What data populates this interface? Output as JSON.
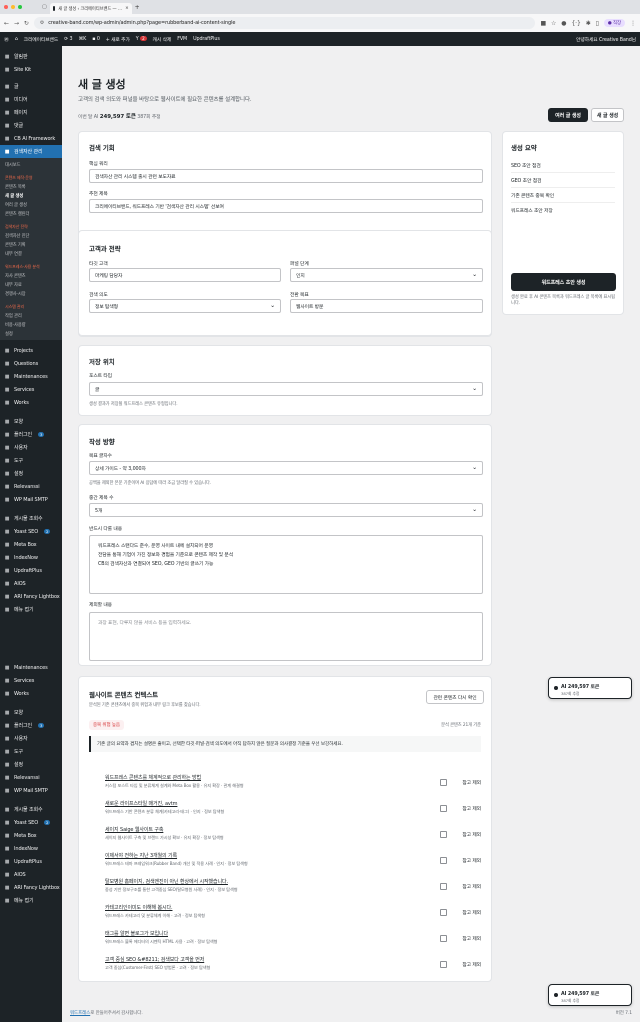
{
  "browser": {
    "tab_title": "새 글 생성 ‹ 크리에이티브밴드 — …",
    "url": "creative-band.com/wp-admin/admin.php?page=rubberband-ai-content-single",
    "profile": "직장",
    "new_tab": "+"
  },
  "adminbar": {
    "site": "크리에이티브밴드",
    "updates": "3",
    "comments": "0",
    "new": "+ 새로 추가",
    "yoast_count": "2",
    "cache": "캐시 삭제",
    "fvm": "FVM",
    "updraft": "UpdraftPlus",
    "greeting": "안녕하세요 Creative Band님"
  },
  "sidebar": {
    "top": [
      {
        "label": "알림판",
        "icon": "dashboard-icon"
      },
      {
        "label": "Site Kit",
        "icon": "sitekit-icon"
      }
    ],
    "mid": [
      {
        "label": "글",
        "icon": "pin-icon"
      },
      {
        "label": "미디어",
        "icon": "media-icon"
      },
      {
        "label": "페이지",
        "icon": "page-icon"
      },
      {
        "label": "댓글",
        "icon": "comment-icon"
      },
      {
        "label": "CB AI Framework",
        "icon": "ai-icon"
      },
      {
        "label": "검색자산 관리",
        "icon": "search-asset-icon"
      }
    ],
    "sub": [
      {
        "label": "대시보드",
        "type": "item"
      },
      {
        "label": "",
        "type": "gap"
      },
      {
        "label": "콘텐츠 제작·운영",
        "type": "grp"
      },
      {
        "label": "콘텐츠 목록",
        "type": "item"
      },
      {
        "label": "새 글 생성",
        "type": "cur"
      },
      {
        "label": "여러 글 생성",
        "type": "item"
      },
      {
        "label": "콘텐츠 캘린더",
        "type": "item"
      },
      {
        "label": "",
        "type": "gap"
      },
      {
        "label": "검색자산 전략",
        "type": "grp"
      },
      {
        "label": "검색자산 진단",
        "type": "item"
      },
      {
        "label": "콘텐츠 기획",
        "type": "item"
      },
      {
        "label": "내부 연결",
        "type": "item"
      },
      {
        "label": "",
        "type": "gap"
      },
      {
        "label": "워드프레스·사용 분석",
        "type": "grp"
      },
      {
        "label": "자사 콘텐츠",
        "type": "item"
      },
      {
        "label": "내부 자료",
        "type": "item"
      },
      {
        "label": "경쟁사·시장",
        "type": "item"
      },
      {
        "label": "",
        "type": "gap"
      },
      {
        "label": "시스템 관리",
        "type": "grp"
      },
      {
        "label": "작업 관리",
        "type": "item"
      },
      {
        "label": "비용·사용량",
        "type": "item"
      },
      {
        "label": "설정",
        "type": "item"
      }
    ],
    "bottom": [
      {
        "label": "Projects",
        "icon": "projects-icon"
      },
      {
        "label": "Questions",
        "icon": "questions-icon"
      },
      {
        "label": "Maintenances",
        "icon": "maintenance-icon"
      },
      {
        "label": "Services",
        "icon": "services-icon"
      },
      {
        "label": "Works",
        "icon": "works-icon"
      },
      {
        "label": "",
        "icon": ""
      },
      {
        "label": "모양",
        "icon": "brush-icon"
      },
      {
        "label": "플러그인",
        "icon": "plugin-icon",
        "count": "3"
      },
      {
        "label": "사용자",
        "icon": "user-icon"
      },
      {
        "label": "도구",
        "icon": "tool-icon"
      },
      {
        "label": "설정",
        "icon": "settings-icon"
      },
      {
        "label": "Relevanssi",
        "icon": "relevanssi-icon"
      },
      {
        "label": "WP Mail SMTP",
        "icon": "mail-icon"
      },
      {
        "label": "",
        "icon": ""
      },
      {
        "label": "게시물 조회수",
        "icon": "chart-icon"
      },
      {
        "label": "Yoast SEO",
        "icon": "yoast-icon",
        "count": "2"
      },
      {
        "label": "Meta Box",
        "icon": "metabox-icon"
      },
      {
        "label": "IndexNow",
        "icon": "indexnow-icon"
      },
      {
        "label": "UpdraftPlus",
        "icon": "updraft-icon"
      },
      {
        "label": "AIOS",
        "icon": "aios-icon"
      },
      {
        "label": "ARI Fancy Lightbox",
        "icon": "lightbox-icon"
      },
      {
        "label": "메뉴 접기",
        "icon": "collapse-icon"
      }
    ],
    "repeat": [
      {
        "label": "Maintenances",
        "icon": "maintenance-icon"
      },
      {
        "label": "Services",
        "icon": "services-icon"
      },
      {
        "label": "Works",
        "icon": "works-icon"
      },
      {
        "label": "",
        "icon": ""
      },
      {
        "label": "모양",
        "icon": "brush-icon"
      },
      {
        "label": "플러그인",
        "icon": "plugin-icon",
        "count": "3"
      },
      {
        "label": "사용자",
        "icon": "user-icon"
      },
      {
        "label": "도구",
        "icon": "tool-icon"
      },
      {
        "label": "설정",
        "icon": "settings-icon"
      },
      {
        "label": "Relevanssi",
        "icon": "relevanssi-icon"
      },
      {
        "label": "WP Mail SMTP",
        "icon": "mail-icon"
      },
      {
        "label": "",
        "icon": ""
      },
      {
        "label": "게시물 조회수",
        "icon": "chart-icon"
      },
      {
        "label": "Yoast SEO",
        "icon": "yoast-icon",
        "count": "2"
      },
      {
        "label": "Meta Box",
        "icon": "metabox-icon"
      },
      {
        "label": "IndexNow",
        "icon": "indexnow-icon"
      },
      {
        "label": "UpdraftPlus",
        "icon": "updraft-icon"
      },
      {
        "label": "AIOS",
        "icon": "aios-icon"
      },
      {
        "label": "ARI Fancy Lightbox",
        "icon": "lightbox-icon"
      },
      {
        "label": "메뉴 접기",
        "icon": "collapse-icon"
      }
    ]
  },
  "page": {
    "title": "새 글 생성",
    "subtitle": "고객의 검색 의도와 퍼널을 바탕으로 웹사이트에 필요한 콘텐츠를 설계합니다.",
    "usage_prefix": "이번 달 AI",
    "usage_tokens": "249,597 토큰",
    "usage_suffix": "387회 추정",
    "btn_multi": "여러 글 생성",
    "btn_single": "새 글 생성"
  },
  "search": {
    "title": "검색 기회",
    "kw_label": "핵심 쿼리",
    "kw_value": "검색자산 관리 시스템 출시 관련 보도자료",
    "title_label": "추천 제목",
    "title_value": "크리에이티브밴드, 워드프레스 기반 '검색자산 관리 시스템' 선보여"
  },
  "strategy": {
    "title": "고객과 전략",
    "target_label": "타깃 고객",
    "target_value": "마케팅 담당자",
    "funnel_label": "퍼널 단계",
    "funnel_value": "인지",
    "intent_label": "검색 의도",
    "intent_value": "정보 탐색형",
    "goal_label": "전환 목표",
    "goal_value": "웹사이트 방문"
  },
  "storage": {
    "title": "저장 위치",
    "type_label": "포스트 타입",
    "type_value": "글",
    "help": "생성 결과가 저장될 워드프레스 콘텐츠 유형입니다."
  },
  "writing": {
    "title": "작성 방향",
    "length_label": "목표 글자수",
    "length_value": "상세 가이드 - 약 3,000자",
    "length_help": "공백을 제외한 본문 기준이며 AI 응답에 따라 조금 달라질 수 있습니다.",
    "heading_label": "중간 제목 수",
    "heading_value": "5개",
    "must_label": "반드시 다룰 내용",
    "must_lines": [
      "워드프레스 스탠다드 준수, 운영 사이트 내에 설치되어 운영",
      "전담을 통해 기업이 가진 정보와 경험을 기준으로 콘텐츠 제작 및 분석",
      "CB의 검색자산과 연결되어 SEO, GEO 기반의 글쓰기 가능"
    ],
    "exclude_label": "제외할 내용",
    "exclude_placeholder": "과장 표현, 다루지 않을 서비스 등을 입력하세요."
  },
  "summary": {
    "title": "생성 요약",
    "items": [
      "SEO 초안 점검",
      "GEO 초안 점검",
      "기존 콘텐츠 중복 확인",
      "워드프레스 초안 저장"
    ],
    "btn": "워드프레스 초안 생성",
    "help": "생성 완료 후 AI 콘텐츠 목록과 워드프레스 글 목록에 표시됩니다."
  },
  "context": {
    "title": "웹사이트 콘텐츠 컨텍스트",
    "subtitle": "분석된 기존 콘텐츠에서 중복 위험과 내부 링크 후보를 찾습니다.",
    "btn": "관련 콘텐츠 다시 확인",
    "chip": "중복 위험 높음",
    "count": "분석 콘텐츠 21개 기준",
    "note": "기존 글의 요약과 겹치는 설명은 줄이고, 선택한 타깃·퍼널·검색 의도에서 아직 답하지 않은 질문과 의사결정 기준을 우선 보강하세요.",
    "exclude": "참고 제외",
    "refs": [
      {
        "t": "워드프레스 콘텐츠를 체계적으로 관리하는 방법",
        "d": "커스텀 포스트 타입 및 분류체계 설계와 Meta Box 활용 · 유지 확장 · 관계 해결형"
      },
      {
        "t": "새로운 라이프스타일 매거진, avtm",
        "d": "워드프레스 기반 콘텐츠 분류 체계(카테고리·태그) · 인지 · 정보 탐색형"
      },
      {
        "t": "세이지 Saige 웹사이트 구축",
        "d": "세이지 웹사이트 구축 및 브랜드 가시성 확보 · 유지 확장 · 정보 탐색형"
      },
      {
        "t": "이제서야 전하는 지난 3개월의 기록",
        "d": "워드프레스 테마 프레임워크(Rubber Band) 개선 및 적용 사례 · 인지 · 정보 탐색형"
      },
      {
        "t": "탈모병원 홈페이지, 검색엔진이 아닌 환상에서 시작했습니다.",
        "d": "중성 기반 정보구조를 통한 고객중심 SEO(탈모병원 사례) · 인지 · 정보 탐색형"
      },
      {
        "t": "카테고리인이미도 이해해 봅시다.",
        "d": "워드프레스 카테고리 및 분류체계 이해 · 고려 · 정보 탐색형"
      },
      {
        "t": "태그를 알면 블로그가 보입니다",
        "d": "워드프레스 블록 에디터의 시멘틱 HTML 사용 · 고려 · 정보 탐색형"
      },
      {
        "t": "고객 중심 SEO &#8211; 검색보다 고객을 먼저",
        "d": "고객 중심(Customer-First) SEO 방법론 · 고려 · 정보 탐색형"
      }
    ]
  },
  "floating": {
    "tokens": "AI 249,597 토큰",
    "count": "387회 추정"
  },
  "footer": {
    "link": "워드프레스",
    "text": "로 만들어주셔서 감사합니다.",
    "version": "버전 7.1"
  }
}
